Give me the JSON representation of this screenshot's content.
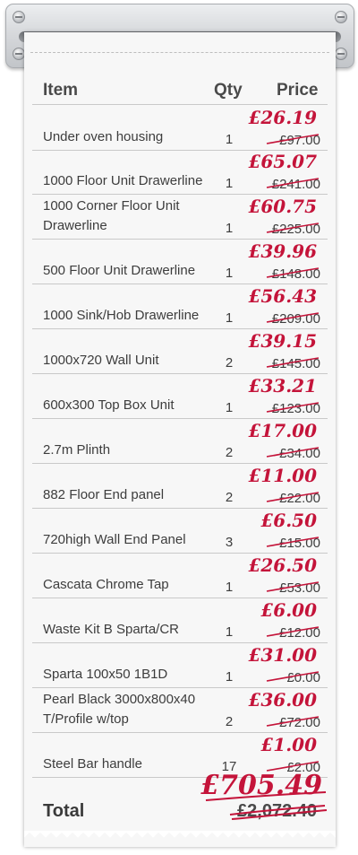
{
  "header": {
    "item": "Item",
    "qty": "Qty",
    "price": "Price"
  },
  "items": [
    {
      "name": "Under oven housing",
      "qty": "1",
      "old": "£97.00",
      "new": "£26.19"
    },
    {
      "name": "1000 Floor Unit Drawerline",
      "qty": "1",
      "old": "£241.00",
      "new": "£65.07"
    },
    {
      "name": "1000 Corner Floor Unit Drawerline",
      "qty": "1",
      "old": "£225.00",
      "new": "£60.75"
    },
    {
      "name": "500 Floor Unit Drawerline",
      "qty": "1",
      "old": "£148.00",
      "new": "£39.96"
    },
    {
      "name": "1000 Sink/Hob Drawerline",
      "qty": "1",
      "old": "£209.00",
      "new": "£56.43"
    },
    {
      "name": "1000x720 Wall Unit",
      "qty": "2",
      "old": "£145.00",
      "new": "£39.15"
    },
    {
      "name": "600x300 Top Box Unit",
      "qty": "1",
      "old": "£123.00",
      "new": "£33.21"
    },
    {
      "name": "2.7m Plinth",
      "qty": "2",
      "old": "£34.00",
      "new": "£17.00"
    },
    {
      "name": "882 Floor End panel",
      "qty": "2",
      "old": "£22.00",
      "new": "£11.00"
    },
    {
      "name": "720high Wall End Panel",
      "qty": "3",
      "old": "£15.00",
      "new": "£6.50"
    },
    {
      "name": "Cascata Chrome Tap",
      "qty": "1",
      "old": "£53.00",
      "new": "£26.50"
    },
    {
      "name": "Waste Kit B Sparta/CR",
      "qty": "1",
      "old": "£12.00",
      "new": "£6.00"
    },
    {
      "name": "Sparta 100x50 1B1D",
      "qty": "1",
      "old": "£0.00",
      "new": "£31.00"
    },
    {
      "name": "Pearl Black 3000x800x40 T/Profile w/top",
      "qty": "2",
      "old": "£72.00",
      "new": "£36.00"
    },
    {
      "name": "Steel Bar handle",
      "qty": "17",
      "old": "£2.00",
      "new": "£1.00"
    }
  ],
  "total": {
    "label": "Total",
    "old": "£2,072.40",
    "new": "£705.49"
  },
  "colors": {
    "handwriting": "#c4143a",
    "paper": "#f7f7f7",
    "text": "#3d3d3d"
  }
}
